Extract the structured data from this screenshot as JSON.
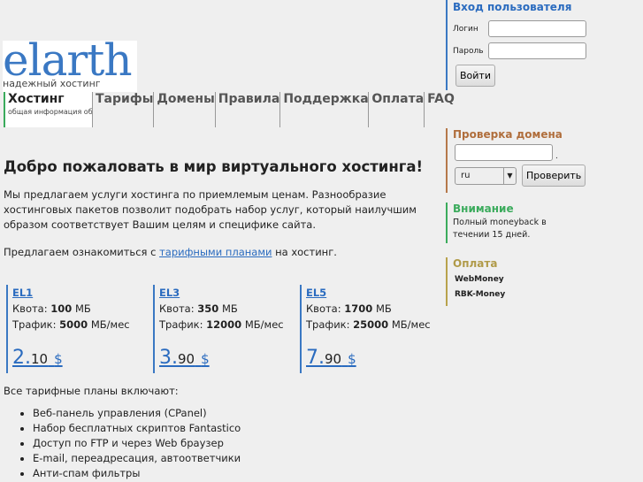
{
  "logo": {
    "name": "elarth",
    "tagline": "надежный хостинг"
  },
  "login": {
    "title": "Вход пользователя",
    "login_label": "Логин",
    "password_label": "Пароль",
    "login_value": "",
    "password_value": "",
    "submit": "Войти"
  },
  "nav": [
    {
      "label": "Хостинг",
      "sub": "общая информация об услугах"
    },
    {
      "label": "Тарифы"
    },
    {
      "label": "Домены"
    },
    {
      "label": "Правила"
    },
    {
      "label": "Поддержка"
    },
    {
      "label": "Оплата"
    },
    {
      "label": "FAQ"
    }
  ],
  "main": {
    "title": "Добро пожаловать в мир виртуального хостинга!",
    "intro": "Мы предлагаем услуги хостинга по приемлемым ценам. Разнообразие хостинговых пакетов позволит подобрать набор услуг, который наилучшим образом соответствует Вашим целям и специфике сайта.",
    "offer_pre": "Предлагаем ознакомиться с ",
    "offer_link": "тарифными планами",
    "offer_post": " на хостинг.",
    "plans": [
      {
        "name": "EL1",
        "quota_label": "Квота:",
        "quota": "100",
        "quota_unit": "МБ",
        "traffic_label": "Трафик:",
        "traffic": "5000",
        "traffic_unit": "МБ/мес",
        "price_int": "2.",
        "price_dec": "10",
        "currency": "$"
      },
      {
        "name": "EL3",
        "quota_label": "Квота:",
        "quota": "350",
        "quota_unit": "МБ",
        "traffic_label": "Трафик:",
        "traffic": "12000",
        "traffic_unit": "МБ/мес",
        "price_int": "3.",
        "price_dec": "90",
        "currency": "$"
      },
      {
        "name": "EL5",
        "quota_label": "Квота:",
        "quota": "1700",
        "quota_unit": "МБ",
        "traffic_label": "Трафик:",
        "traffic": "25000",
        "traffic_unit": "МБ/мес",
        "price_int": "7.",
        "price_dec": "90",
        "currency": "$"
      }
    ],
    "includes_title": "Все тарифные планы включают:",
    "includes": [
      "Веб-панель управления (CPanel)",
      "Набор бесплатных скриптов Fantastico",
      "Доступ по FTP и через Web браузер",
      "E-mail, переадресация, автоответчики",
      "Анти-спам фильтры"
    ]
  },
  "domain_check": {
    "title": "Проверка домена",
    "value": "",
    "dot": ".",
    "zone": "ru",
    "button": "Проверить"
  },
  "notice": {
    "title": "Внимание",
    "text": "Полный moneyback в течении 15 дней."
  },
  "payment": {
    "title": "Оплата",
    "items": [
      "WebMoney",
      "RBK-Money"
    ]
  }
}
